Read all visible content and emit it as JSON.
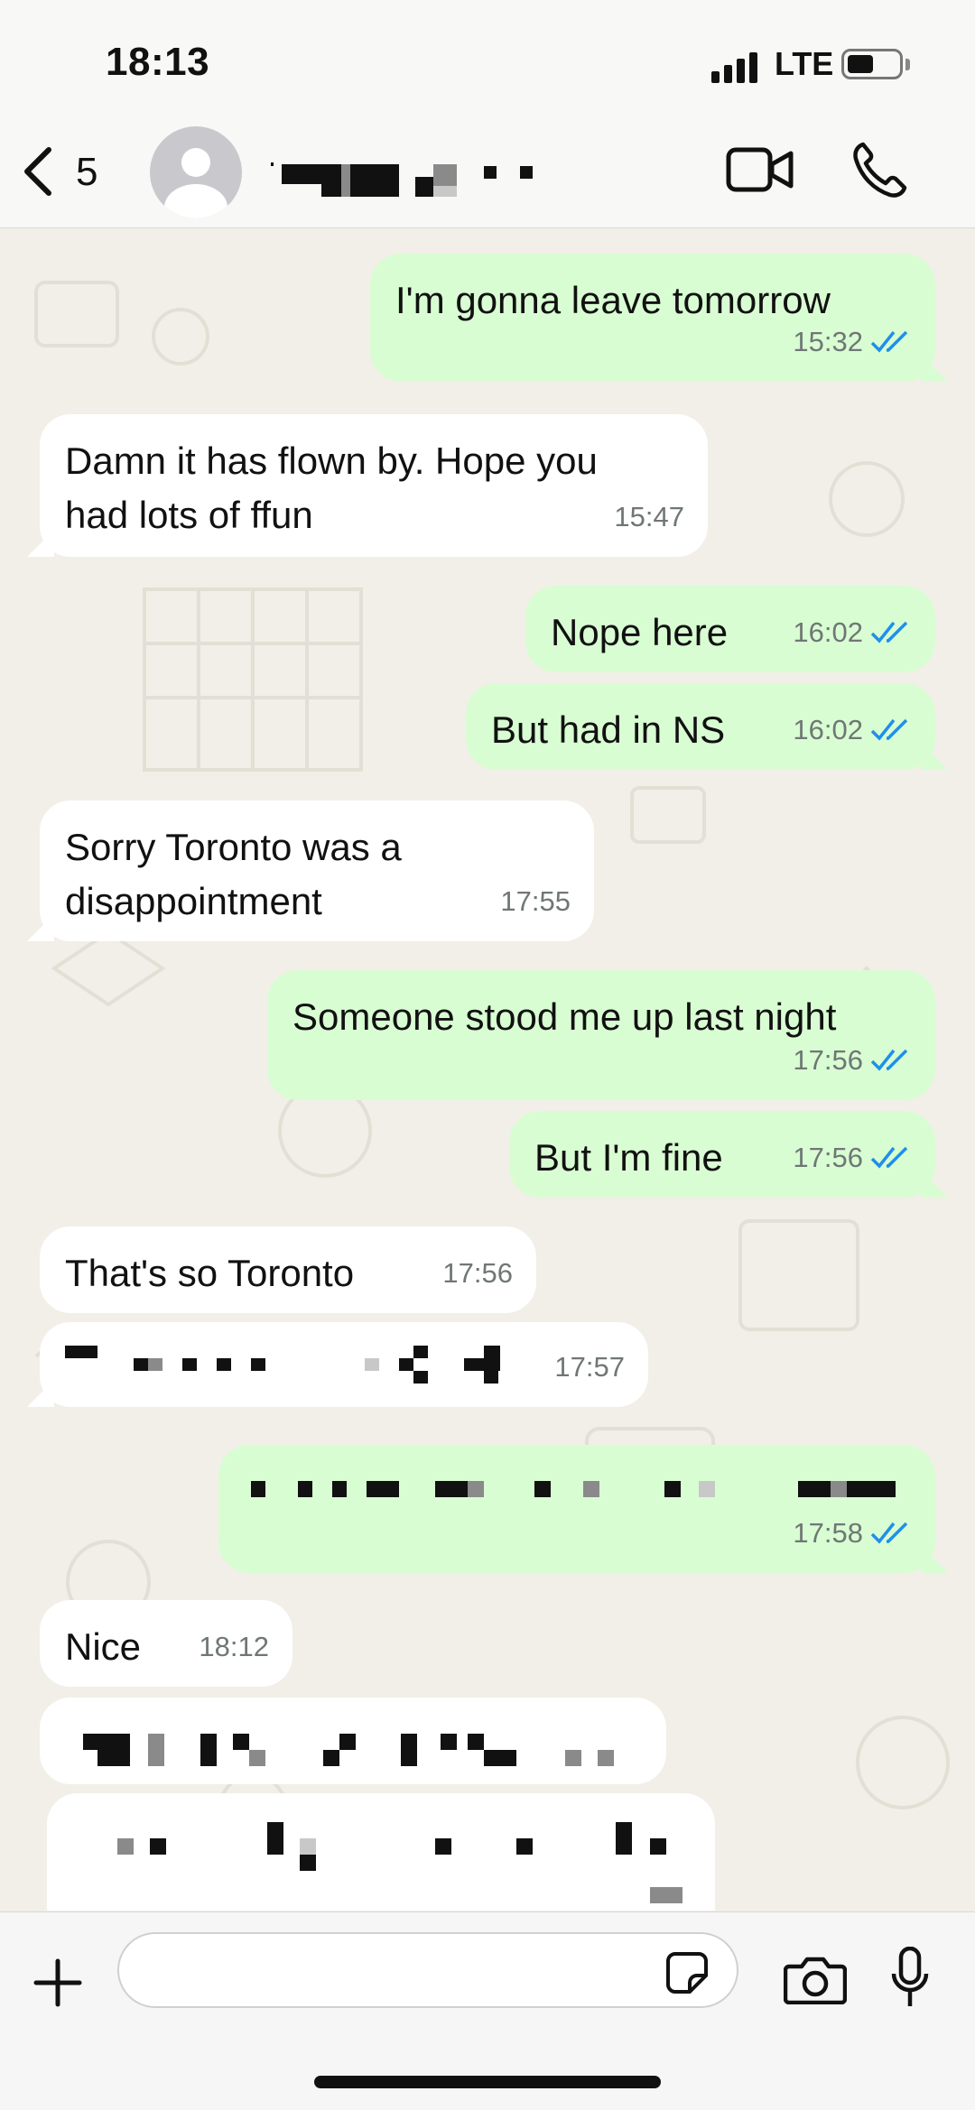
{
  "status_bar": {
    "time": "18:13",
    "network": "LTE"
  },
  "header": {
    "back_count": "5"
  },
  "input": {
    "placeholder": ""
  },
  "messages": [
    {
      "dir": "out",
      "text": "I'm gonna leave tomorrow",
      "time": "15:32"
    },
    {
      "dir": "in",
      "text": "Damn it has flown by. Hope you\nhad lots of ffun",
      "time": "15:47"
    },
    {
      "dir": "out",
      "text": "Nope here",
      "time": "16:02"
    },
    {
      "dir": "out",
      "text": "But had in NS",
      "time": "16:02"
    },
    {
      "dir": "in",
      "text": "Sorry Toronto was a\ndisappointment",
      "time": "17:55"
    },
    {
      "dir": "out",
      "text": "Someone stood me up last night",
      "time": "17:56"
    },
    {
      "dir": "out",
      "text": "But I'm fine",
      "time": "17:56"
    },
    {
      "dir": "in",
      "text": "That's so Toronto",
      "time": "17:56"
    },
    {
      "dir": "in",
      "text": "",
      "time": "17:57",
      "redacted": true
    },
    {
      "dir": "out",
      "text": "",
      "time": "17:58",
      "redacted": true
    },
    {
      "dir": "in",
      "text": "Nice",
      "time": "18:12"
    },
    {
      "dir": "in",
      "text": "",
      "time": "",
      "redacted": true
    },
    {
      "dir": "in",
      "text": "",
      "time": "",
      "redacted": true
    }
  ],
  "colors": {
    "outgoing_bubble": "#d9fdd3",
    "incoming_bubble": "#ffffff",
    "read_checks": "#1f8fea",
    "wallpaper": "#f2efe8"
  }
}
